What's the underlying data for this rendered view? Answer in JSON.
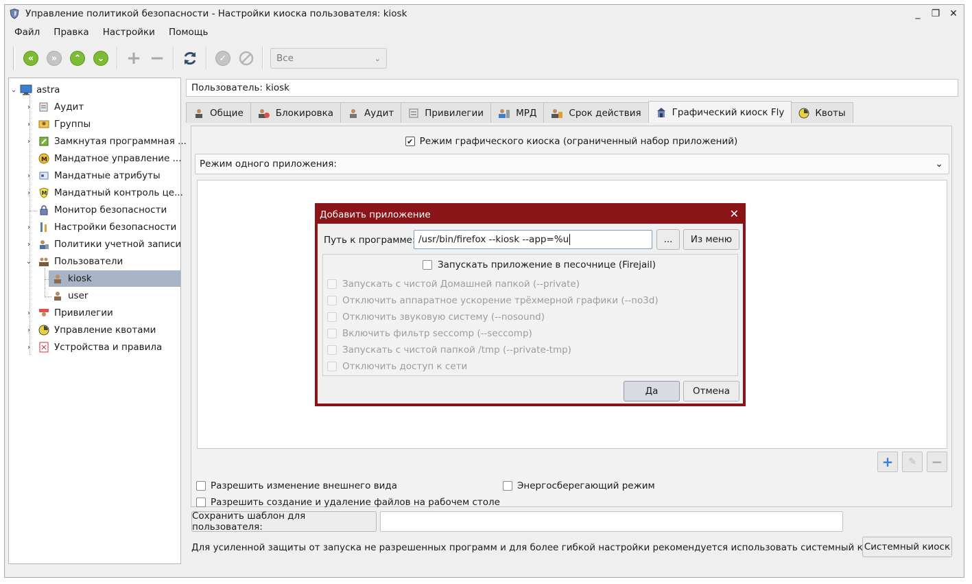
{
  "window": {
    "title": "Управление политикой безопасности - Настройки киоска пользователя: kiosk",
    "controls": [
      "_",
      "❐",
      "✕"
    ]
  },
  "menu": [
    "Файл",
    "Правка",
    "Настройки",
    "Помощь"
  ],
  "toolbar": {
    "filter_value": "Все"
  },
  "tree": {
    "root": "astra",
    "items": [
      {
        "label": "Аудит",
        "icon": "audit-icon"
      },
      {
        "label": "Группы",
        "icon": "groups-icon"
      },
      {
        "label": "Замкнутая программная ...",
        "icon": "closed-software-icon"
      },
      {
        "label": "Мандатное управление ...",
        "icon": "mandatory-control-icon"
      },
      {
        "label": "Мандатные атрибуты",
        "icon": "mandatory-attributes-icon"
      },
      {
        "label": "Мандатный контроль це...",
        "icon": "integrity-control-icon"
      },
      {
        "label": "Монитор безопасности",
        "icon": "lock-icon"
      },
      {
        "label": "Настройки безопасности",
        "icon": "security-settings-icon"
      },
      {
        "label": "Политики учетной записи",
        "icon": "account-policy-icon"
      },
      {
        "label": "Пользователи",
        "icon": "users-icon"
      },
      {
        "label": "kiosk",
        "icon": "user-icon"
      },
      {
        "label": "user",
        "icon": "user-icon"
      },
      {
        "label": "Привилегии",
        "icon": "privileges-icon"
      },
      {
        "label": "Управление квотами",
        "icon": "quota-icon"
      },
      {
        "label": "Устройства и правила",
        "icon": "devices-icon"
      }
    ]
  },
  "user_field": "Пользователь: kiosk",
  "tabs": [
    {
      "label": "Общие",
      "icon": "user-icon"
    },
    {
      "label": "Блокировка",
      "icon": "lock-user-icon"
    },
    {
      "label": "Аудит",
      "icon": "audit-icon"
    },
    {
      "label": "Привилегии",
      "icon": "privileges-icon"
    },
    {
      "label": "МРД",
      "icon": "mrd-icon"
    },
    {
      "label": "Срок действия",
      "icon": "expiry-icon"
    },
    {
      "label": "Графический киоск Fly",
      "icon": "kiosk-icon"
    },
    {
      "label": "Квоты",
      "icon": "quota-icon"
    }
  ],
  "kiosk": {
    "mode_label": "Режим графического киоска (ограниченный набор приложений)",
    "mode_checked": true,
    "single_app_mode": "Режим одного приложения:",
    "allow_appearance": "Разрешить изменение внешнего вида",
    "energy_saving": "Энергосберегающий режим",
    "allow_desktop_files": "Разрешить создание и удаление файлов на рабочем столе",
    "save_template": "Сохранить шаблон для пользователя:",
    "hint": "Для усиленной защиты от запуска не разрешенных программ и для более гибкой настройки рекомендуется использовать системный киоск:",
    "system_kiosk": "Системный киоск"
  },
  "dialog": {
    "title": "Добавить приложение",
    "path_label": "Путь к программе:",
    "path_value": "/usr/bin/firefox --kiosk --app=%u",
    "browse": "...",
    "from_menu": "Из меню",
    "sandbox": "Запускать приложение в песочнице (Firejail)",
    "options": [
      "Запускать с чистой Домашней папкой (--private)",
      "Отключить аппаратное ускорение трёхмерной графики (--no3d)",
      "Отключить звуковую систему (--nosound)",
      "Включить фильтр seccomp (--seccomp)",
      "Запускать с чистой папкой /tmp (--private-tmp)",
      "Отключить доступ к сети"
    ],
    "ok": "Да",
    "cancel": "Отмена"
  }
}
